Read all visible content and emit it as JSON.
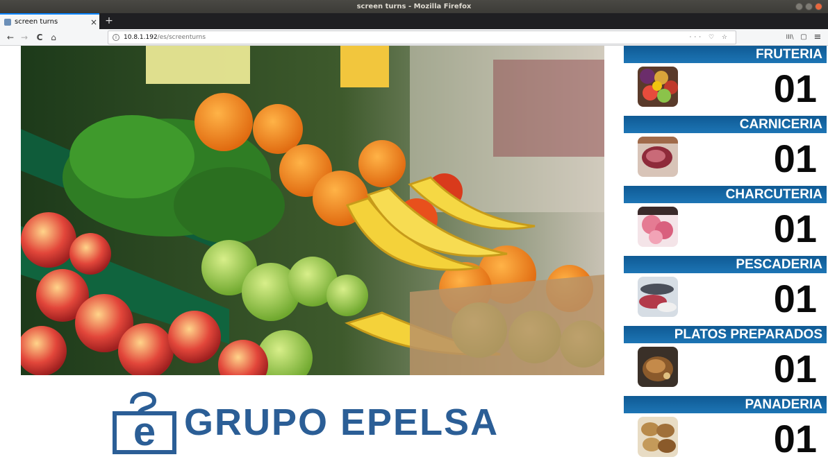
{
  "window": {
    "title": "screen turns - Mozilla Firefox"
  },
  "tabs": [
    {
      "label": "screen turns",
      "close": "×"
    }
  ],
  "newtab": "+",
  "nav": {
    "back": "←",
    "forward": "→",
    "reload": "C",
    "home": "⌂"
  },
  "address": {
    "host": "10.8.1.192",
    "path": "/es/screenturns",
    "actions": "··· ♡ ☆"
  },
  "toolbar": {
    "library": "III\\",
    "sidebar": "▢",
    "menu": "≡"
  },
  "logo": {
    "text": "GRUPO EPELSA"
  },
  "sections": [
    {
      "name": "FRUTERIA",
      "turn": "01"
    },
    {
      "name": "CARNICERIA",
      "turn": "01"
    },
    {
      "name": "CHARCUTERIA",
      "turn": "01"
    },
    {
      "name": "PESCADERIA",
      "turn": "01"
    },
    {
      "name": "PLATOS PREPARADOS",
      "turn": "01"
    },
    {
      "name": "PANADERIA",
      "turn": "01"
    }
  ]
}
